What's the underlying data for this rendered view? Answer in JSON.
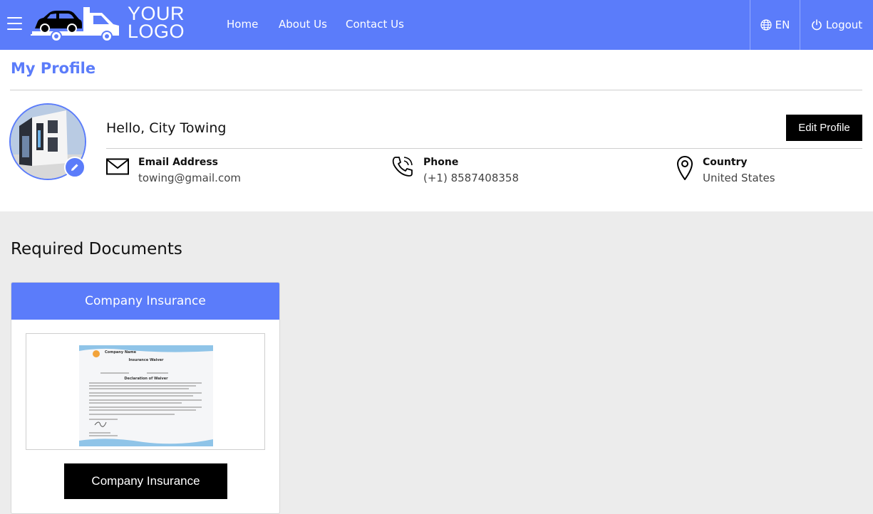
{
  "navbar": {
    "logo_line1": "YOUR",
    "logo_line2": "LOGO",
    "links": [
      "Home",
      "About Us",
      "Contact Us"
    ],
    "language": "EN",
    "logout": "Logout",
    "color": "#5b7cfa"
  },
  "profile": {
    "title": "My Profile",
    "greeting": "Hello, City Towing",
    "edit_button": "Edit Profile",
    "email": {
      "label": "Email Address",
      "value": "towing@gmail.com",
      "icon": "envelope-icon"
    },
    "phone": {
      "label": "Phone",
      "value": "(+1) 8587408358",
      "icon": "phone-icon"
    },
    "country": {
      "label": "Country",
      "value": "United States",
      "icon": "location-pin-icon"
    }
  },
  "documents": {
    "title": "Required Documents",
    "items": [
      {
        "header": "Company Insurance",
        "button": "Company Insurance",
        "preview": {
          "company": "Company Name",
          "heading": "Insurance Waiver",
          "subheading": "Declaration of Waiver"
        }
      }
    ]
  }
}
